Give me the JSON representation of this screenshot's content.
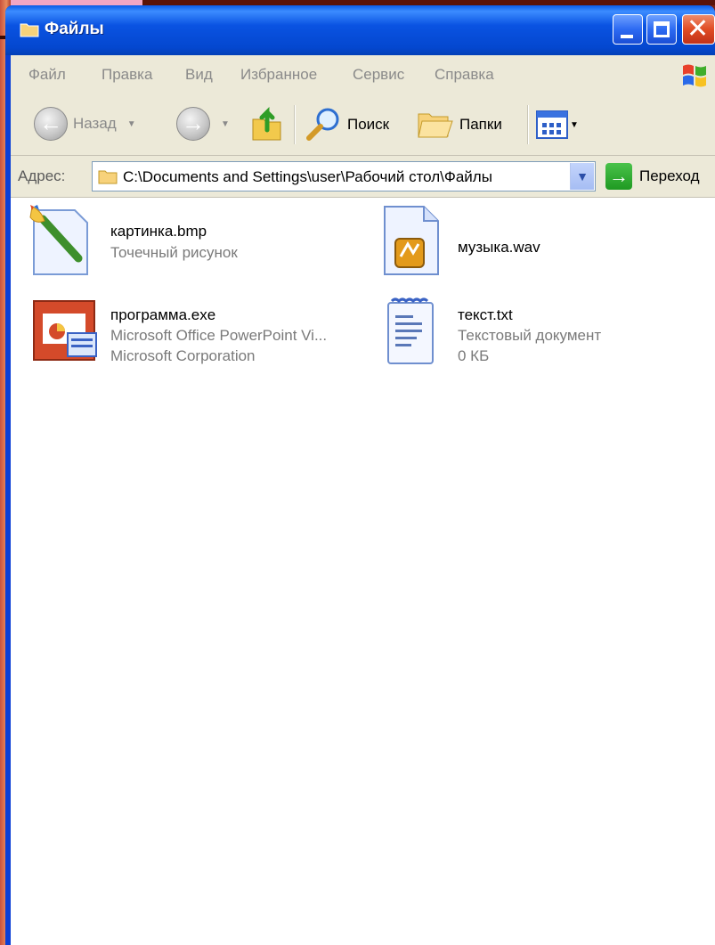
{
  "window": {
    "title": "Файлы"
  },
  "menu": [
    "Файл",
    "Правка",
    "Вид",
    "Избранное",
    "Сервис",
    "Справка"
  ],
  "toolbar": {
    "back_label": "Назад",
    "search_label": "Поиск",
    "folders_label": "Папки"
  },
  "address": {
    "label": "Адрес:",
    "path": "C:\\Documents and Settings\\user\\Рабочий стол\\Файлы",
    "go_label": "Переход"
  },
  "files": [
    {
      "name": "картинка.bmp",
      "line1": "Точечный рисунок",
      "line2": "",
      "icon": "paint-brush-icon"
    },
    {
      "name": "музыка.wav",
      "line1": "",
      "line2": "",
      "icon": "audio-file-icon"
    },
    {
      "name": "программа.exe",
      "line1": "Microsoft Office PowerPoint Vi...",
      "line2": "Microsoft Corporation",
      "icon": "powerpoint-icon"
    },
    {
      "name": "текст.txt",
      "line1": "Текстовый документ",
      "line2": "0 КБ",
      "icon": "text-document-icon"
    }
  ],
  "colors": {
    "titlebar": "#0a53e2",
    "chrome": "#ece9d8",
    "close": "#e04c24"
  }
}
